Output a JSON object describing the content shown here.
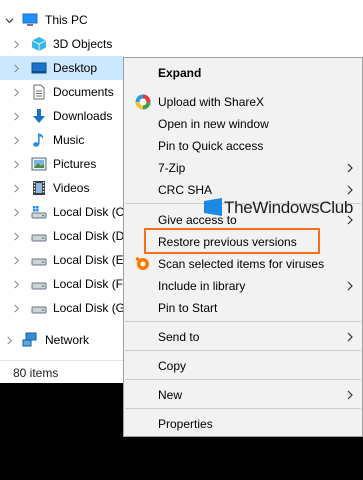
{
  "nav": {
    "items": [
      {
        "label": "This PC",
        "icon": "computer-icon",
        "expanded": true
      },
      {
        "label": "3D Objects",
        "icon": "cube-3d-icon"
      },
      {
        "label": "Desktop",
        "icon": "desktop-icon",
        "selected": true
      },
      {
        "label": "Documents",
        "icon": "document-icon"
      },
      {
        "label": "Downloads",
        "icon": "download-arrow-icon"
      },
      {
        "label": "Music",
        "icon": "music-note-icon"
      },
      {
        "label": "Pictures",
        "icon": "pictures-icon"
      },
      {
        "label": "Videos",
        "icon": "film-icon"
      },
      {
        "label": "Local Disk (C:",
        "icon": "windows-drive-icon"
      },
      {
        "label": "Local Disk (D:",
        "icon": "drive-icon"
      },
      {
        "label": "Local Disk (E:",
        "icon": "drive-icon"
      },
      {
        "label": "Local Disk (F:)",
        "icon": "drive-icon"
      },
      {
        "label": "Local Disk (G:",
        "icon": "drive-icon"
      },
      {
        "label": "Network",
        "icon": "network-icon"
      }
    ],
    "selected_color": "#cce8ff"
  },
  "status": {
    "items_count": "80 items"
  },
  "context_menu": {
    "items": [
      {
        "label": "Expand",
        "bold": true
      },
      {
        "label": "Upload with ShareX",
        "icon": "sharex-icon"
      },
      {
        "label": "Open in new window"
      },
      {
        "label": "Pin to Quick access"
      },
      {
        "label": "7-Zip",
        "submenu": true
      },
      {
        "label": "CRC SHA",
        "submenu": true
      },
      {
        "label": "Give access to",
        "submenu": true
      },
      {
        "label": "Restore previous versions",
        "highlighted": true
      },
      {
        "label": "Scan selected items for viruses",
        "icon": "avast-icon"
      },
      {
        "label": "Include in library",
        "submenu": true
      },
      {
        "label": "Pin to Start"
      },
      {
        "label": "Send to",
        "submenu": true
      },
      {
        "label": "Copy"
      },
      {
        "label": "New",
        "submenu": true
      },
      {
        "label": "Properties"
      }
    ],
    "highlight_color": "#f36f21"
  },
  "watermark": {
    "text": "TheWindowsClub"
  }
}
